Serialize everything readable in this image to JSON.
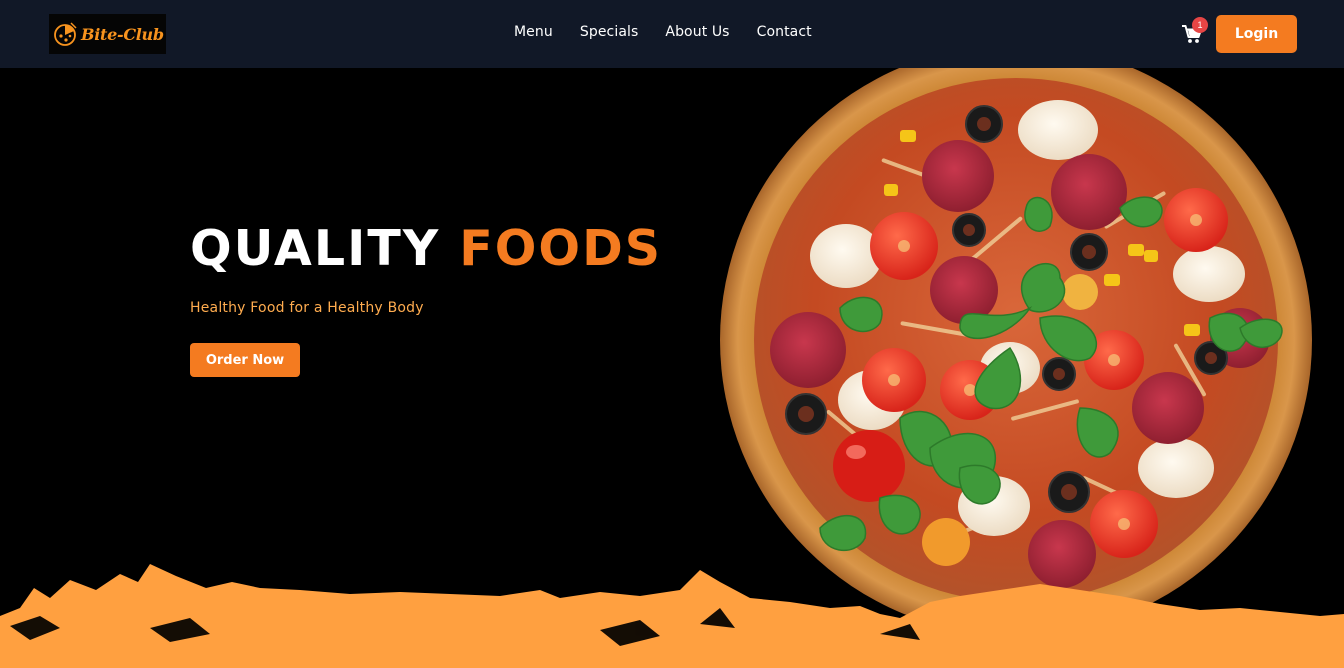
{
  "brand": {
    "name": "Bite-Club",
    "logo_icon": "pizza-icon",
    "accent": "#f47b20"
  },
  "nav": {
    "items": [
      {
        "label": "Menu"
      },
      {
        "label": "Specials"
      },
      {
        "label": "About Us"
      },
      {
        "label": "Contact"
      }
    ]
  },
  "header": {
    "cart_icon": "shopping-cart-icon",
    "cart_badge": "1",
    "login_label": "Login"
  },
  "hero": {
    "title_part1": "QUALITY",
    "title_part2": "FOODS",
    "subtitle": "Healthy Food for a Healthy Body",
    "cta_label": "Order Now",
    "image": "pizza-image",
    "colors": {
      "background": "#000000",
      "splash": "#ffa040",
      "title_accent": "#f47b20",
      "subtitle": "#ffac4f"
    }
  }
}
